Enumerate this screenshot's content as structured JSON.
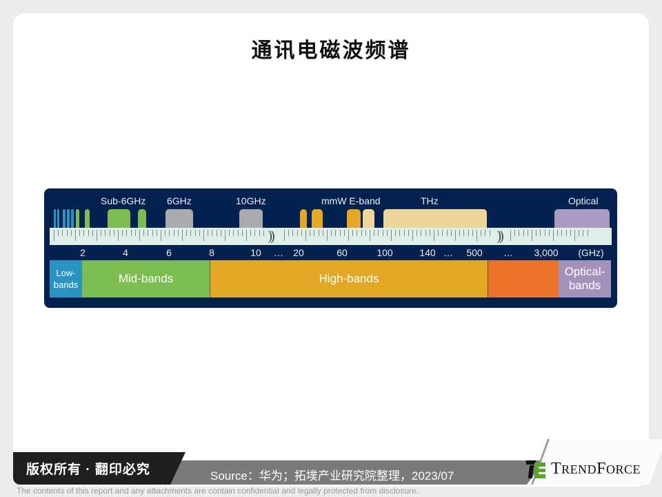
{
  "title": "通讯电磁波频谱",
  "chart_data": {
    "type": "diagram",
    "title": "通讯电磁波频谱",
    "unit": "(GHz)",
    "axis_ticks": [
      "2",
      "4",
      "6",
      "8",
      "10",
      "…",
      "20",
      "60",
      "100",
      "140",
      "…",
      "500",
      "…",
      "3,000",
      "(GHz)"
    ],
    "band_labels": [
      "Sub-6GHz",
      "6GHz",
      "10GHz",
      "mmW E-band",
      "THz",
      "Optical"
    ],
    "blocks": [
      {
        "name": "low-band-1",
        "group": "Low-bands",
        "color": "#2a93c0"
      },
      {
        "name": "low-band-2",
        "group": "Low-bands",
        "color": "#2a93c0"
      },
      {
        "name": "low-band-3",
        "group": "Low-bands",
        "color": "#2a93c0"
      },
      {
        "name": "low-band-4",
        "group": "Low-bands",
        "color": "#2a93c0"
      },
      {
        "name": "low-band-5",
        "group": "Low-bands",
        "color": "#2a93c0"
      },
      {
        "name": "mid-band-1",
        "group": "Sub-6GHz",
        "color": "#7dbd51"
      },
      {
        "name": "mid-band-2",
        "group": "Sub-6GHz",
        "color": "#7dbd51"
      },
      {
        "name": "mid-band-3",
        "group": "Sub-6GHz",
        "color": "#7dbd51"
      },
      {
        "name": "mid-band-4",
        "group": "Sub-6GHz",
        "color": "#7dbd51"
      },
      {
        "name": "band-6ghz",
        "group": "6GHz",
        "color": "#a8aaae"
      },
      {
        "name": "band-10ghz",
        "group": "10GHz",
        "color": "#a8aaae"
      },
      {
        "name": "mmw-1",
        "group": "mmW",
        "color": "#e2a825"
      },
      {
        "name": "mmw-2",
        "group": "mmW",
        "color": "#e2a825"
      },
      {
        "name": "e-band-1",
        "group": "E-band",
        "color": "#e2a825"
      },
      {
        "name": "e-band-2",
        "group": "E-band",
        "color": "#eed59a"
      },
      {
        "name": "thz-band",
        "group": "THz",
        "color": "#eed59a"
      },
      {
        "name": "optical-band",
        "group": "Optical",
        "color": "#aa9bc3"
      }
    ],
    "categories": [
      {
        "label": "Low-bands",
        "color": "#2a93c0",
        "range": "< 2 GHz"
      },
      {
        "label": "Mid-bands",
        "color": "#7dbd51",
        "range": "2–8 GHz"
      },
      {
        "label": "High-bands",
        "color": "#e2a825",
        "range": "8–500 GHz"
      },
      {
        "label": "",
        "color": "#ec7229",
        "range": "500–3,000 GHz"
      },
      {
        "label": "Optical-bands",
        "color": "#a393bb",
        "range": "> 3,000 GHz"
      }
    ]
  },
  "diagram": {
    "band_labels": {
      "sub6": "Sub-6GHz",
      "g6": "6GHz",
      "g10": "10GHz",
      "mmw": "mmW E-band",
      "thz": "THz",
      "optical": "Optical"
    },
    "ticks": {
      "t2": "2",
      "t4": "4",
      "t6": "6",
      "t8": "8",
      "t10": "10",
      "e1": "…",
      "t20": "20",
      "t60": "60",
      "t100": "100",
      "t140": "140",
      "e2": "…",
      "t500": "500",
      "e3": "…",
      "t3000": "3,000",
      "unit": "(GHz)"
    },
    "categories": {
      "low1": "Low-",
      "low2": "bands",
      "mid": "Mid-bands",
      "high": "High-bands",
      "thz": "",
      "opt1": "Optical-",
      "opt2": "bands"
    }
  },
  "footer": {
    "copyright": "版权所有 · 翻印必究",
    "source": "Source：华为；拓墣产业研究院整理，2023/07",
    "logo_main": "T",
    "logo_rend": "REND",
    "logo_f": "F",
    "logo_orce": "ORCE",
    "disclaimer": "The contents of this report and any attachments are contain confidential and legally protected from disclosure."
  }
}
